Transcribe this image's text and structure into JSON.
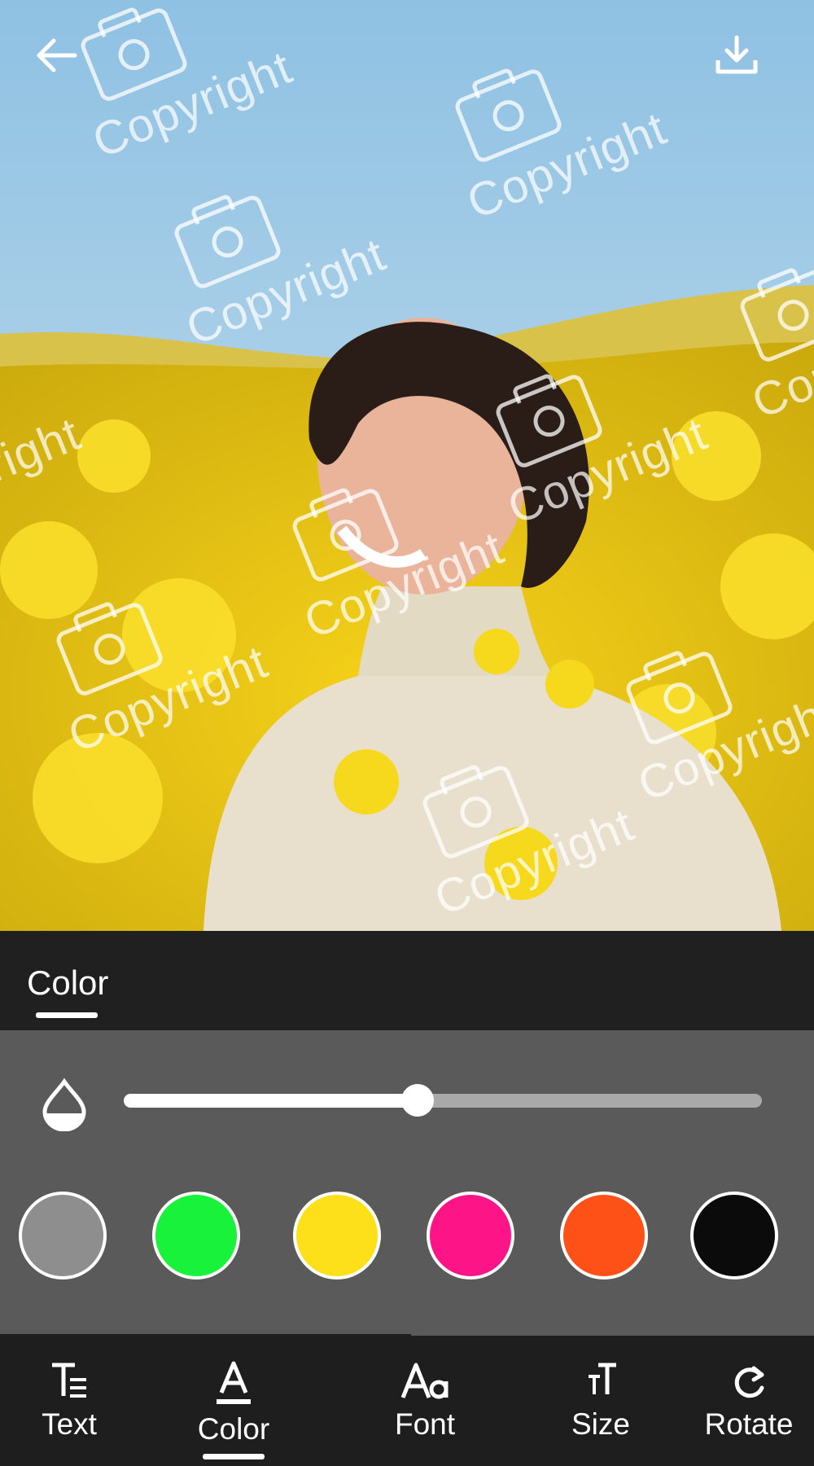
{
  "photo": {
    "watermark_text": "Copyright"
  },
  "header": {
    "back_icon": "arrow-left-icon",
    "download_icon": "download-icon"
  },
  "panel": {
    "active_tab": "Color",
    "opacity_icon": "opacity-drop-icon",
    "opacity_value": 0.46
  },
  "swatches": [
    {
      "name": "gray",
      "color": "#8e8e8e"
    },
    {
      "name": "green",
      "color": "#19f23a"
    },
    {
      "name": "yellow",
      "color": "#fde01a"
    },
    {
      "name": "pink",
      "color": "#fd1487"
    },
    {
      "name": "orange",
      "color": "#fe5117"
    },
    {
      "name": "black",
      "color": "#0b0b0b"
    }
  ],
  "toolbar": {
    "items": [
      {
        "label": "Text",
        "icon": "text-format-icon"
      },
      {
        "label": "Color",
        "icon": "text-color-icon",
        "active": true
      },
      {
        "label": "Font",
        "icon": "font-icon"
      },
      {
        "label": "Size",
        "icon": "text-size-icon"
      },
      {
        "label": "Rotate",
        "icon": "rotate-icon"
      }
    ]
  }
}
